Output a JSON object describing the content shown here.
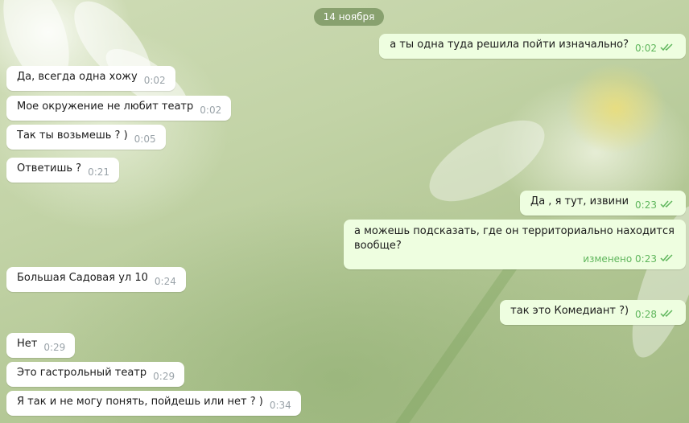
{
  "date_divider": "14 ноября",
  "messages": [
    {
      "dir": "out",
      "text": "а ты одна туда решила пойти изначально?",
      "time": "0:02",
      "read": true
    },
    {
      "dir": "in",
      "text": "Да, всегда одна хожу",
      "time": "0:02"
    },
    {
      "dir": "in",
      "text": "Мое окружение не любит театр",
      "time": "0:02"
    },
    {
      "dir": "in",
      "text": "Так ты возьмешь ? )",
      "time": "0:05"
    },
    {
      "dir": "in",
      "text": "Ответишь ?",
      "time": "0:21"
    },
    {
      "dir": "out",
      "text": "Да , я тут, извини",
      "time": "0:23",
      "read": true
    },
    {
      "dir": "out",
      "text": "а можешь подсказать, где он территориально находится вообще?",
      "time": "изменено 0:23",
      "read": true
    },
    {
      "dir": "in",
      "text": "Большая Садовая ул 10",
      "time": "0:24"
    },
    {
      "dir": "out",
      "text": "так это Комедиант ?)",
      "time": "0:28",
      "read": true
    },
    {
      "dir": "in",
      "text": "Нет",
      "time": "0:29"
    },
    {
      "dir": "in",
      "text": "Это гастрольный театр",
      "time": "0:29"
    },
    {
      "dir": "in",
      "text": "Я так и не могу понять, пойдешь или нет ? )",
      "time": "0:34"
    }
  ],
  "colors": {
    "incoming_bubble": "#ffffff",
    "outgoing_bubble": "#eefee0",
    "read_tick": "#5fb65c",
    "date_pill": "#708c58"
  },
  "icons": {
    "read_status": "double-check-icon"
  }
}
